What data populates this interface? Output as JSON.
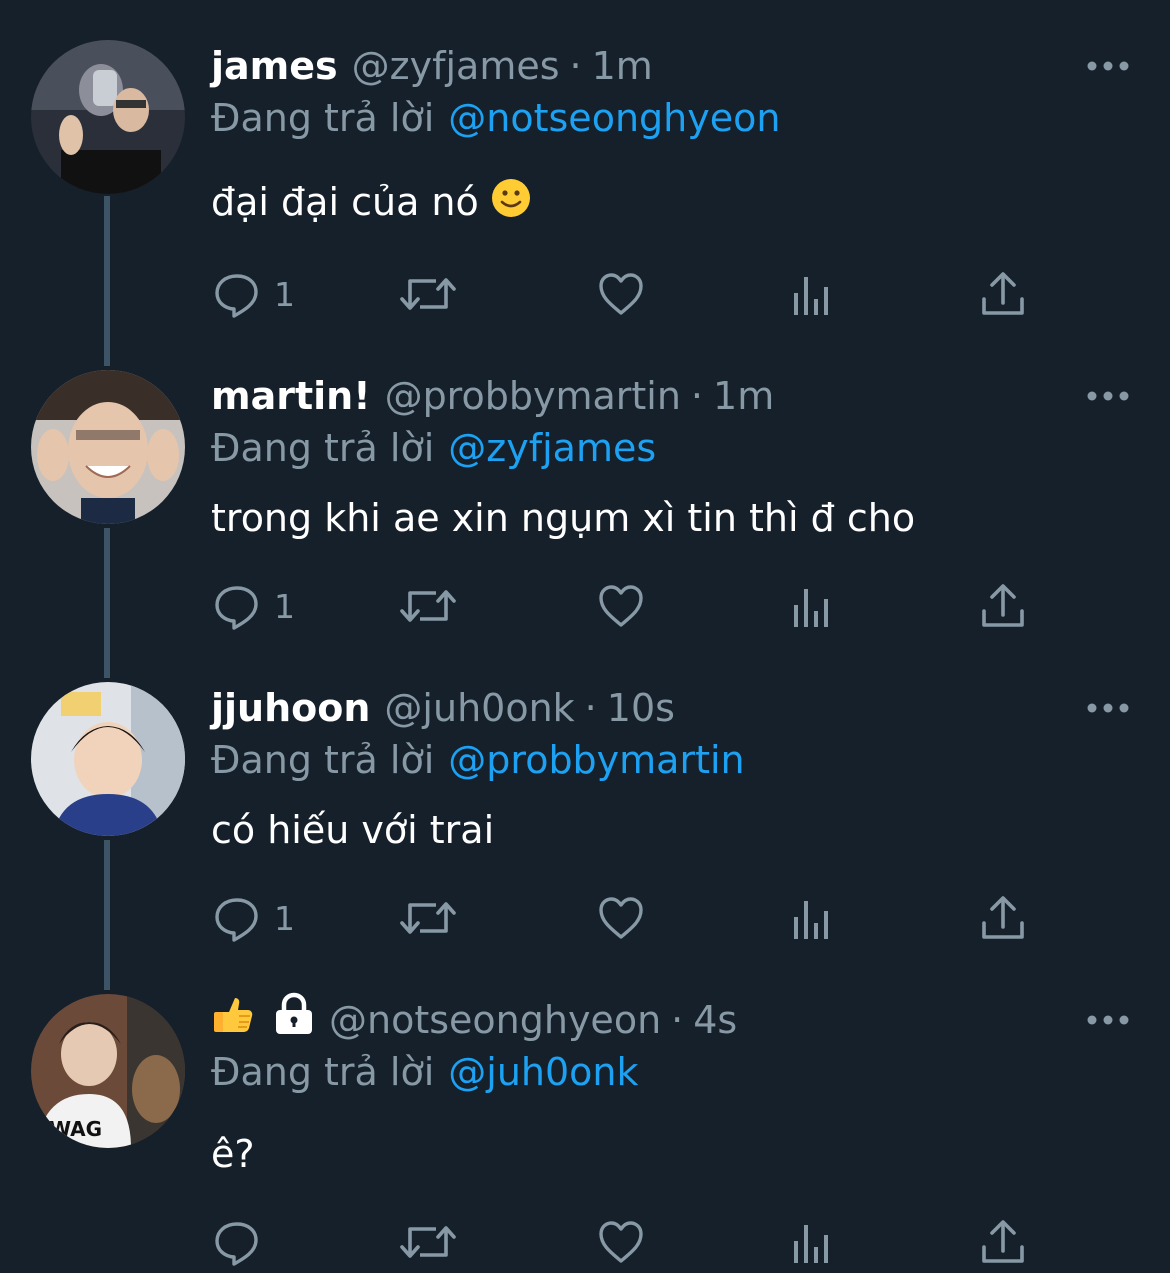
{
  "tweets": [
    {
      "name": "james",
      "handle": "@zyfjames",
      "separator": "·",
      "time": "1m",
      "reply_prefix": "Đang trả lời",
      "reply_to": "@notseonghyeon",
      "text": "đại đại của nó",
      "reply_count": "1",
      "avatar_icon": "avatar-photo"
    },
    {
      "name": "martin!",
      "handle": "@probbymartin",
      "separator": "·",
      "time": "1m",
      "reply_prefix": "Đang trả lời",
      "reply_to": "@zyfjames",
      "text": "trong khi ae xin ngụm xì tin thì đ cho",
      "reply_count": "1",
      "avatar_icon": "avatar-photo"
    },
    {
      "name": "jjuhoon",
      "handle": "@juh0onk",
      "separator": "·",
      "time": "10s",
      "reply_prefix": "Đang trả lời",
      "reply_to": "@probbymartin",
      "text": "có hiếu với trai",
      "reply_count": "1",
      "avatar_icon": "avatar-photo"
    },
    {
      "name": "👍 🔒",
      "handle": "@notseonghyeon",
      "separator": "·",
      "time": "4s",
      "reply_prefix": "Đang trả lời",
      "reply_to": "@juh0onk",
      "text": "ê?",
      "reply_count": "",
      "avatar_icon": "avatar-photo"
    }
  ],
  "icons": {
    "reply": "comment-icon",
    "retweet": "retweet-icon",
    "like": "heart-icon",
    "analytics": "analytics-icon",
    "share": "share-icon",
    "more": "more-icon"
  },
  "colors": {
    "background": "#15202b",
    "secondary_text": "#8899a6",
    "accent": "#1da1f2",
    "thread_line": "#3d5466"
  }
}
